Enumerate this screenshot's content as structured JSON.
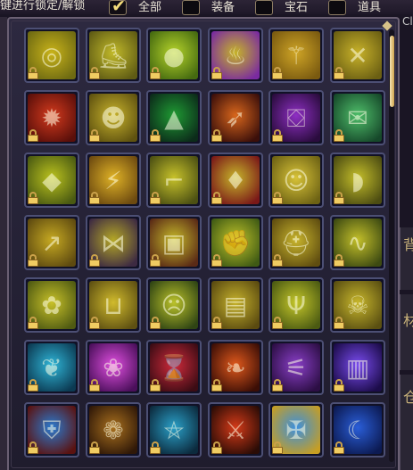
{
  "header": {
    "lock_hint": "键进行锁定/解锁",
    "filters": [
      {
        "label": "全部",
        "checked": true
      },
      {
        "label": "装备",
        "checked": false
      },
      {
        "label": "宝石",
        "checked": false
      },
      {
        "label": "道具",
        "checked": false
      }
    ],
    "edge_text": "Cl"
  },
  "side_tabs": [
    {
      "text": "背包"
    },
    {
      "text": "材料"
    },
    {
      "text": "仓库"
    }
  ],
  "slots": [
    {
      "icon": "gold-ring-icon",
      "locked": true,
      "colors": [
        "#c9b31a",
        "#6e6a12"
      ],
      "glyph": "◎"
    },
    {
      "icon": "boots-icon",
      "locked": true,
      "colors": [
        "#c2ba2a",
        "#5f5b14"
      ],
      "glyph": "⛸"
    },
    {
      "icon": "green-orb-icon",
      "locked": true,
      "colors": [
        "#b6d42b",
        "#456a10"
      ],
      "glyph": "●"
    },
    {
      "icon": "flame-torch-icon",
      "locked": true,
      "colors": [
        "#c6b428",
        "#7a2aa0"
      ],
      "glyph": "♨"
    },
    {
      "icon": "broom-icon",
      "locked": true,
      "colors": [
        "#cfa526",
        "#7a5a10"
      ],
      "glyph": "⚚"
    },
    {
      "icon": "crossed-staff-icon",
      "locked": true,
      "colors": [
        "#c9b32a",
        "#6b5f13"
      ],
      "glyph": "✕"
    },
    {
      "icon": "fire-spell-icon",
      "locked": true,
      "colors": [
        "#d43a1d",
        "#5a0f0a"
      ],
      "glyph": "✹"
    },
    {
      "icon": "pumpkin-icon",
      "locked": true,
      "colors": [
        "#c9b42c",
        "#5f5210"
      ],
      "glyph": "☻"
    },
    {
      "icon": "christmas-tree-icon",
      "locked": true,
      "colors": [
        "#1f9a33",
        "#0c2b1a"
      ],
      "glyph": "▲"
    },
    {
      "icon": "flame-sword-icon",
      "locked": true,
      "colors": [
        "#d8661c",
        "#3b0f0a"
      ],
      "glyph": "➶"
    },
    {
      "icon": "witch-hat-icon",
      "locked": true,
      "colors": [
        "#8f2fc4",
        "#2a0c3d"
      ],
      "glyph": "⛋"
    },
    {
      "icon": "envelope-icon",
      "locked": true,
      "colors": [
        "#4fbf6a",
        "#16482a"
      ],
      "glyph": "✉"
    },
    {
      "icon": "armor-icon",
      "locked": true,
      "colors": [
        "#bbc21e",
        "#4a5a12"
      ],
      "glyph": "◆"
    },
    {
      "icon": "golden-blade-icon",
      "locked": true,
      "colors": [
        "#e0b326",
        "#6d4a10"
      ],
      "glyph": "⚡"
    },
    {
      "icon": "gun-icon",
      "locked": true,
      "colors": [
        "#c7c22a",
        "#4c5013"
      ],
      "glyph": "⌐"
    },
    {
      "icon": "red-crystal-icon",
      "locked": true,
      "colors": [
        "#c6b52a",
        "#7a1818"
      ],
      "glyph": "♦"
    },
    {
      "icon": "doll-face-icon",
      "locked": true,
      "colors": [
        "#d8c338",
        "#6d6214"
      ],
      "glyph": "☺"
    },
    {
      "icon": "slipper-icon",
      "locked": true,
      "colors": [
        "#c4be2a",
        "#4c4c12"
      ],
      "glyph": "◗"
    },
    {
      "icon": "arrows-icon",
      "locked": true,
      "colors": [
        "#c7aa22",
        "#5e4a10"
      ],
      "glyph": "↗"
    },
    {
      "icon": "dark-wings-icon",
      "locked": true,
      "colors": [
        "#b5a826",
        "#3d2a42"
      ],
      "glyph": "⋈"
    },
    {
      "icon": "chest-armor-icon",
      "locked": true,
      "colors": [
        "#c6ba2a",
        "#5a2a16"
      ],
      "glyph": "▣"
    },
    {
      "icon": "gauntlet-icon",
      "locked": true,
      "colors": [
        "#c1c42a",
        "#3f5a14"
      ],
      "glyph": "✊"
    },
    {
      "icon": "golden-helm-icon",
      "locked": true,
      "colors": [
        "#c8b42c",
        "#5f4d10"
      ],
      "glyph": "⛑"
    },
    {
      "icon": "lizard-icon",
      "locked": true,
      "colors": [
        "#c4c02a",
        "#3d4a12"
      ],
      "glyph": "∿"
    },
    {
      "icon": "pet-creature-icon",
      "locked": true,
      "colors": [
        "#c8c129",
        "#4f5a12"
      ],
      "glyph": "✿"
    },
    {
      "icon": "golden-boot-icon",
      "locked": true,
      "colors": [
        "#d1bb2c",
        "#5e5012"
      ],
      "glyph": "⊔"
    },
    {
      "icon": "warrior-face-icon",
      "locked": true,
      "colors": [
        "#bbc22a",
        "#2f4414"
      ],
      "glyph": "☹"
    },
    {
      "icon": "scroll-book-icon",
      "locked": true,
      "colors": [
        "#c6b22c",
        "#5a4a10"
      ],
      "glyph": "▤"
    },
    {
      "icon": "horned-orb-icon",
      "locked": true,
      "colors": [
        "#c4c62a",
        "#4b5a12"
      ],
      "glyph": "Ψ"
    },
    {
      "icon": "skull-mask-icon",
      "locked": true,
      "colors": [
        "#c8b72c",
        "#5a4f12"
      ],
      "glyph": "☠"
    },
    {
      "icon": "white-wing-icon",
      "locked": true,
      "colors": [
        "#2fb6d8",
        "#0c3a52"
      ],
      "glyph": "❦"
    },
    {
      "icon": "pink-rose-icon",
      "locked": true,
      "colors": [
        "#e04fe0",
        "#4a0f5a"
      ],
      "glyph": "❀"
    },
    {
      "icon": "hourglass-icon",
      "locked": true,
      "colors": [
        "#d02a3b",
        "#3b0c14"
      ],
      "glyph": "⌛"
    },
    {
      "icon": "fire-leaf-icon",
      "locked": true,
      "colors": [
        "#e0591c",
        "#3b0e06"
      ],
      "glyph": "❧"
    },
    {
      "icon": "wooden-broom-icon",
      "locked": true,
      "colors": [
        "#8a3fc8",
        "#2c0e44"
      ],
      "glyph": "⚟"
    },
    {
      "icon": "purple-book-icon",
      "locked": true,
      "colors": [
        "#7a4cf0",
        "#1c0c4a"
      ],
      "glyph": "▥"
    },
    {
      "icon": "shield-crest-icon",
      "locked": true,
      "colors": [
        "#2b7bd0",
        "#5a1210"
      ],
      "glyph": "⛨"
    },
    {
      "icon": "spiral-staff-icon",
      "locked": true,
      "colors": [
        "#a9701e",
        "#2f1808"
      ],
      "glyph": "❁"
    },
    {
      "icon": "pentagram-icon",
      "locked": true,
      "colors": [
        "#2aa0c8",
        "#0c2a3d"
      ],
      "glyph": "⛤"
    },
    {
      "icon": "flame-blade-icon",
      "locked": true,
      "colors": [
        "#d43a18",
        "#2a0c06"
      ],
      "glyph": "⚔"
    },
    {
      "icon": "crossed-swords-icon",
      "locked": true,
      "colors": [
        "#3a8fe0",
        "#c79e22"
      ],
      "glyph": "✠"
    },
    {
      "icon": "moon-scythe-icon",
      "locked": true,
      "colors": [
        "#2a5ed8",
        "#0c1a52"
      ],
      "glyph": "☾"
    }
  ]
}
